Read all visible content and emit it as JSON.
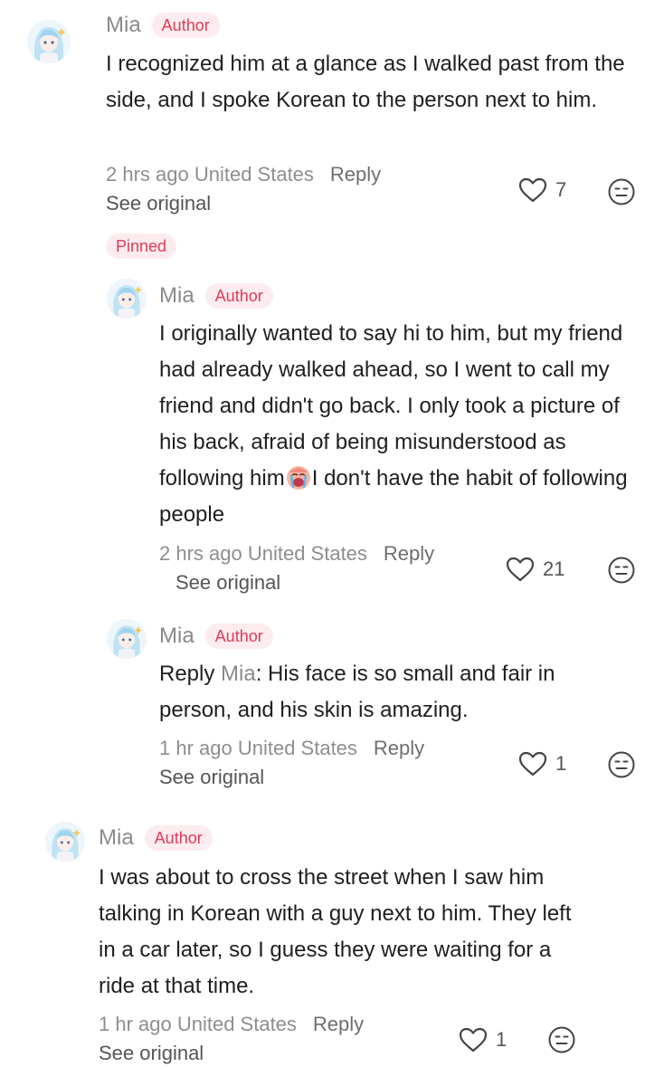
{
  "comments": [
    {
      "username": "Mia",
      "badge": "Author",
      "text": "I recognized him at a glance as I walked past from the side, and I spoke Korean to the person next to him.",
      "time_location": "2 hrs ago United States",
      "reply_label": "Reply",
      "see_original": "See original",
      "likes": "7",
      "pinned_label": "Pinned"
    },
    {
      "username": "Mia",
      "badge": "Author",
      "text_before_emoji": "I originally wanted to say hi to him, but my friend had already walked ahead, so I went to call my friend and didn't go back. I only took a picture of his back, afraid of being misunderstood as following him",
      "text_after_emoji": "I don't have the habit of following people",
      "emoji": "crying-face-emoji",
      "time_location": "2 hrs ago United States",
      "reply_label": "Reply",
      "see_original": "See original",
      "likes": "21"
    },
    {
      "username": "Mia",
      "badge": "Author",
      "reply_prefix": "Reply",
      "reply_to": "Mia",
      "text": ": His face is so small and fair in person, and his skin is amazing.",
      "time_location": "1 hr ago United States",
      "reply_label": "Reply",
      "see_original": "See original",
      "likes": "1"
    },
    {
      "username": "Mia",
      "badge": "Author",
      "text": "I was about to cross the street when I saw him talking in Korean with a guy next to him. They left in a car later, so I guess they were waiting for a ride at that time.",
      "time_location": "1 hr ago United States",
      "reply_label": "Reply",
      "see_original": "See original",
      "likes": "1"
    }
  ],
  "icons": {
    "like": "heart-outline-icon",
    "dislike": "neutral-face-icon"
  },
  "colors": {
    "badge_text": "#e23a58",
    "badge_bg": "#fdecef",
    "meta_text": "#8e8e8e"
  }
}
